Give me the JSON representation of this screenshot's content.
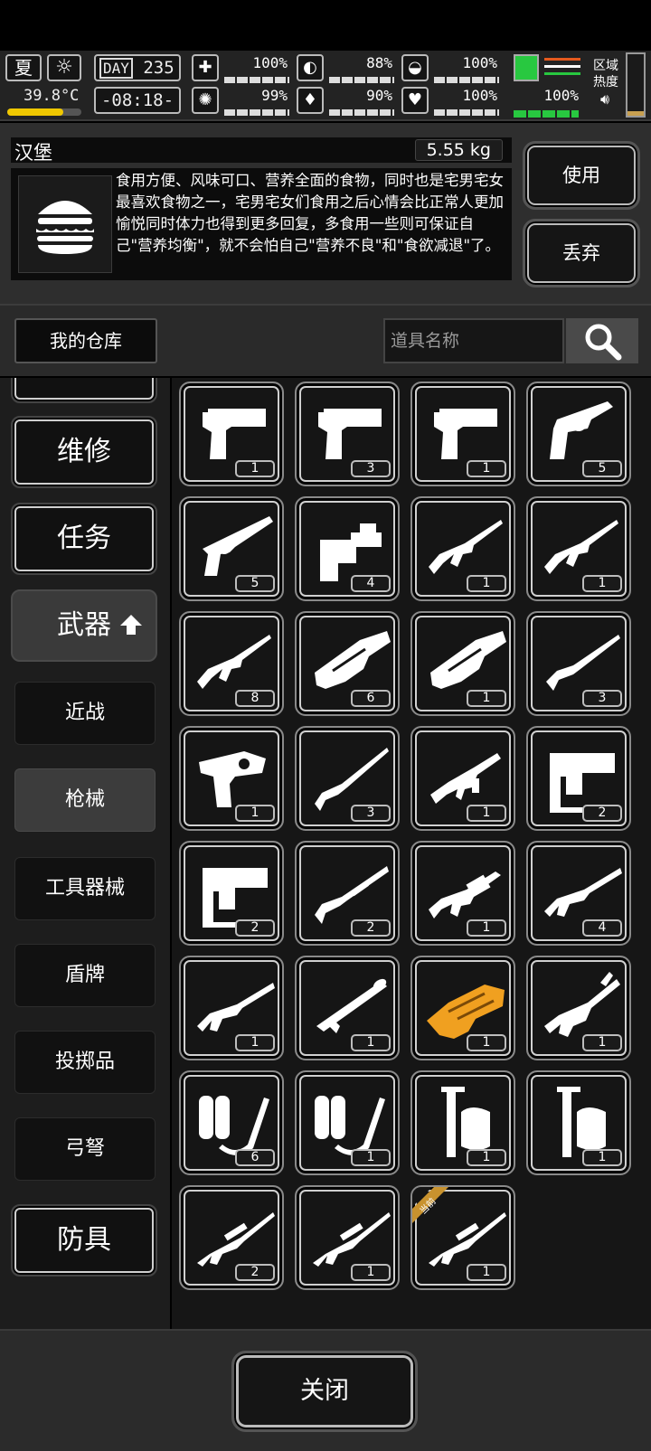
{
  "hud": {
    "season": "夏",
    "temperature": "39.8°C",
    "temperature_level": 0.75,
    "day_label": "DAY",
    "day_number": "235",
    "time": "-08:18-",
    "stats": [
      {
        "icon": "medkit-icon",
        "glyph": "✚",
        "value": "100%"
      },
      {
        "icon": "stomach-icon",
        "glyph": "◐",
        "value": "88%"
      },
      {
        "icon": "helmet-icon",
        "glyph": "◒",
        "value": "100%"
      },
      {
        "icon": "brain-icon",
        "glyph": "✺",
        "value": "99%"
      },
      {
        "icon": "water-drop-icon",
        "glyph": "♦",
        "value": "90%"
      },
      {
        "icon": "heart-icon",
        "glyph": "♥",
        "value": "100%"
      }
    ],
    "stamina_value": "100%",
    "zone_label": "区域热度",
    "zone_heat_level": 0.08
  },
  "item": {
    "name": "汉堡",
    "weight": "5.55 kg",
    "description": "食用方便、风味可口、营养全面的食物，同时也是宅男宅女最喜欢食物之一，宅男宅女们食用之后心情会比正常人更加愉悦同时体力也得到更多回复，多食用一些则可保证自己\"营养均衡\"，就不会怕自己\"营养不良\"和\"食欲减退\"了。",
    "icon": "burger-icon",
    "use_label": "使用",
    "drop_label": "丢弃"
  },
  "warehouse": {
    "tab_label": "我的仓库",
    "search_placeholder": "道具名称"
  },
  "categories": {
    "repair": "维修",
    "task": "任务",
    "weapons": "武器",
    "armor": "防具",
    "subs": [
      "近战",
      "枪械",
      "工具器械",
      "盾牌",
      "投掷品",
      "弓弩"
    ],
    "selected_sub": "枪械"
  },
  "weapons": [
    {
      "icon": "desert-eagle-icon",
      "qty": "1"
    },
    {
      "icon": "desert-eagle-icon",
      "qty": "3"
    },
    {
      "icon": "desert-eagle-icon",
      "qty": "1"
    },
    {
      "icon": "revolver-icon",
      "qty": "5"
    },
    {
      "icon": "revolver-long-icon",
      "qty": "5"
    },
    {
      "icon": "nail-gun-icon",
      "qty": "4"
    },
    {
      "icon": "assault-rifle-icon",
      "qty": "1"
    },
    {
      "icon": "assault-rifle-icon",
      "qty": "1"
    },
    {
      "icon": "assault-rifle-icon",
      "qty": "8"
    },
    {
      "icon": "minigun-icon",
      "qty": "6"
    },
    {
      "icon": "minigun-icon",
      "qty": "1"
    },
    {
      "icon": "shotgun-icon",
      "qty": "3"
    },
    {
      "icon": "flare-gun-icon",
      "qty": "1"
    },
    {
      "icon": "hunting-rifle-icon",
      "qty": "3"
    },
    {
      "icon": "submachine-gun-icon",
      "qty": "1"
    },
    {
      "icon": "heavy-nailer-icon",
      "qty": "2"
    },
    {
      "icon": "heavy-nailer-icon",
      "qty": "2"
    },
    {
      "icon": "pump-shotgun-icon",
      "qty": "2"
    },
    {
      "icon": "grenade-launcher-rifle-icon",
      "qty": "1"
    },
    {
      "icon": "combat-shotgun-icon",
      "qty": "4"
    },
    {
      "icon": "combat-shotgun-icon",
      "qty": "1"
    },
    {
      "icon": "rocket-launcher-icon",
      "qty": "1"
    },
    {
      "icon": "golden-blaster-icon",
      "qty": "1"
    },
    {
      "icon": "plasma-rifle-icon",
      "qty": "1"
    },
    {
      "icon": "flamethrower-icon",
      "qty": "6"
    },
    {
      "icon": "flamethrower-icon",
      "qty": "1"
    },
    {
      "icon": "sprayer-icon",
      "qty": "1"
    },
    {
      "icon": "sprayer-icon",
      "qty": "1"
    },
    {
      "icon": "sniper-rifle-icon",
      "qty": "2"
    },
    {
      "icon": "sniper-rifle-icon",
      "qty": "1"
    },
    {
      "icon": "sniper-rifle-icon",
      "qty": "1",
      "badge": "当前"
    }
  ],
  "footer": {
    "close_label": "关闭"
  },
  "colors": {
    "stamina": "#28c840",
    "temperature": "#f0c800",
    "badge": "#c8922e",
    "golden": "#f0a020"
  }
}
